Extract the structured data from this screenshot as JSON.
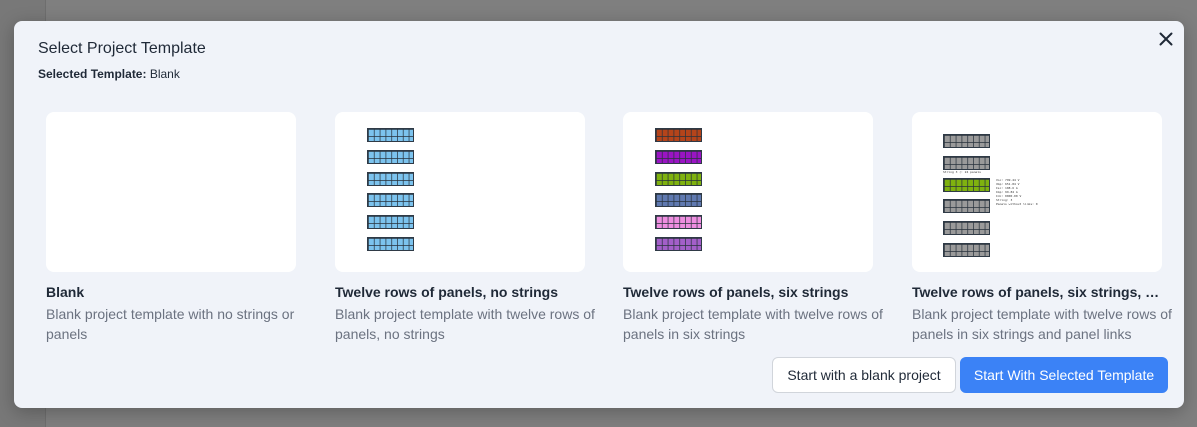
{
  "dialog": {
    "title": "Select Project Template",
    "selected_label": "Selected Template:",
    "selected_value": "Blank",
    "close_icon": "close-icon"
  },
  "templates": [
    {
      "name": "Blank",
      "description": "Blank project template with no strings or panels",
      "preview_colors": []
    },
    {
      "name": "Twelve rows of panels, no strings",
      "description": "Blank project template with twelve rows of panels, no strings",
      "preview_colors": [
        "#7cc3ee",
        "#7cc3ee",
        "#7cc3ee",
        "#7cc3ee",
        "#7cc3ee",
        "#7cc3ee"
      ]
    },
    {
      "name": "Twelve rows of panels, six strings",
      "description": "Blank project template with twelve rows of panels in six strings",
      "preview_colors": [
        "#b5441a",
        "#9a14c4",
        "#7fb20f",
        "#5f79b0",
        "#ee8ee0",
        "#a35fc9"
      ]
    },
    {
      "name": "Twelve rows of panels, six strings, panel links",
      "description": "Blank project template with twelve rows of panels in six strings and panel links",
      "preview_colors": [
        "#9a9a9a",
        "#9a9a9a",
        "#7fb20f",
        "#9a9a9a",
        "#9a9a9a",
        "#9a9a9a"
      ],
      "preview_caption": "String 3 (: 24 panels",
      "preview_details": "Voc: 799.44 V\nVmp: 651.84 V\nIsc: 108.6 A\nImp: 99.84 A\nIdc: 0000.00 V\nString: 3\nPanels without links: 0"
    }
  ],
  "buttons": {
    "blank_project": "Start with a blank project",
    "start_selected": "Start With Selected Template"
  },
  "colors": {
    "accent": "#3b82f6",
    "dialog_bg": "#f0f3f9",
    "overlay": "#7f7f7f"
  }
}
